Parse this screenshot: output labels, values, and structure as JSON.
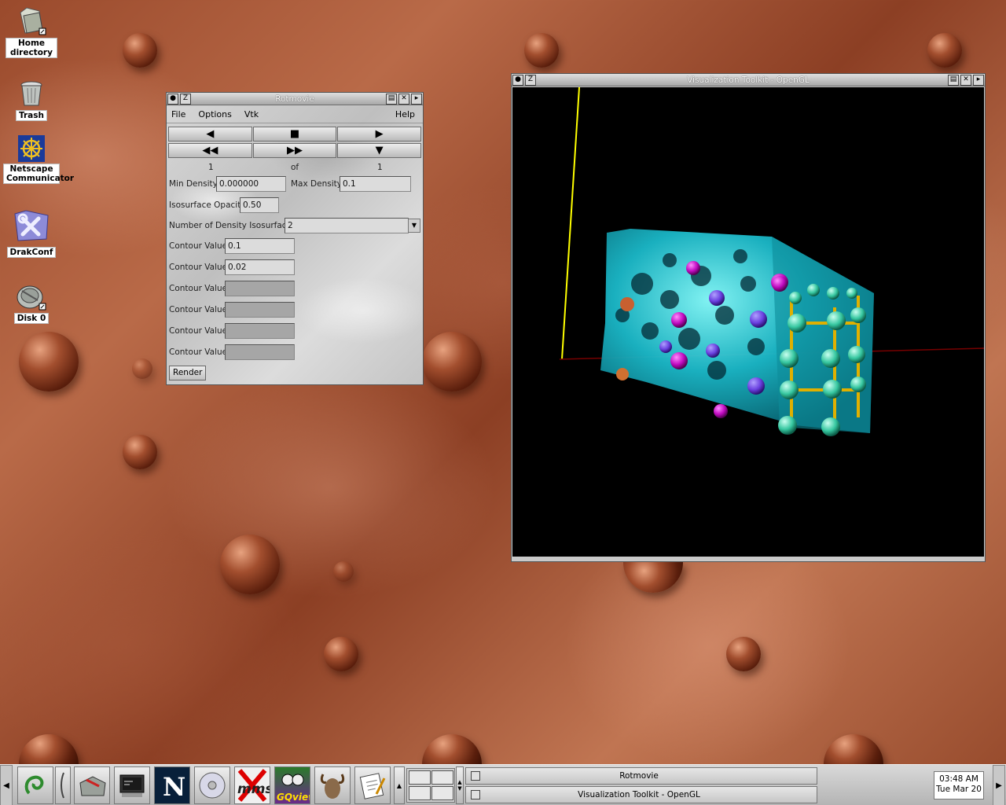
{
  "desktop": {
    "icons": [
      {
        "label": "Home directory",
        "icon": "folder-icon"
      },
      {
        "label": "Trash",
        "icon": "trash-icon"
      },
      {
        "label": "Netscape Communicator",
        "icon": "netscape-wheel-icon"
      },
      {
        "label": "DrakConf",
        "icon": "drakconf-tools-icon"
      },
      {
        "label": "Disk 0",
        "icon": "harddisk-icon"
      }
    ]
  },
  "rotmovie": {
    "title": "Rotmovie",
    "menu": {
      "file": "File",
      "options": "Options",
      "vtk": "Vtk",
      "help": "Help"
    },
    "frame_current": "1",
    "frame_of": "of",
    "frame_total": "1",
    "min_density_label": "Min Density",
    "min_density_value": "0.000000",
    "max_density_label": "Max Density",
    "max_density_value": "0.1",
    "opacity_label": "Isosurface Opacity",
    "opacity_value": "0.50",
    "num_iso_label": "Number of Density Isosurfaces",
    "num_iso_value": "2",
    "contours": [
      {
        "label": "Contour Value",
        "value": "0.1"
      },
      {
        "label": "Contour Value",
        "value": "0.02"
      },
      {
        "label": "Contour Value",
        "value": ""
      },
      {
        "label": "Contour Value",
        "value": ""
      },
      {
        "label": "Contour Value",
        "value": ""
      },
      {
        "label": "Contour Value",
        "value": ""
      }
    ],
    "render_label": "Render"
  },
  "vtk": {
    "title": "Visualization Toolkit - OpenGL"
  },
  "taskbar": {
    "launchers": [
      "gnome-foot-icon",
      "toolbox-icon",
      "terminal-icon",
      "netscape-icon",
      "cd-icon",
      "mms-icon",
      "gqview-icon",
      "gnu-icon",
      "notepad-icon"
    ],
    "mms_label": "mms",
    "gqview_label": "GQview",
    "tasks": [
      "Rotmovie",
      "Visualization Toolkit - OpenGL"
    ],
    "clock_time": "03:48 AM",
    "clock_date": "Tue Mar 20"
  }
}
